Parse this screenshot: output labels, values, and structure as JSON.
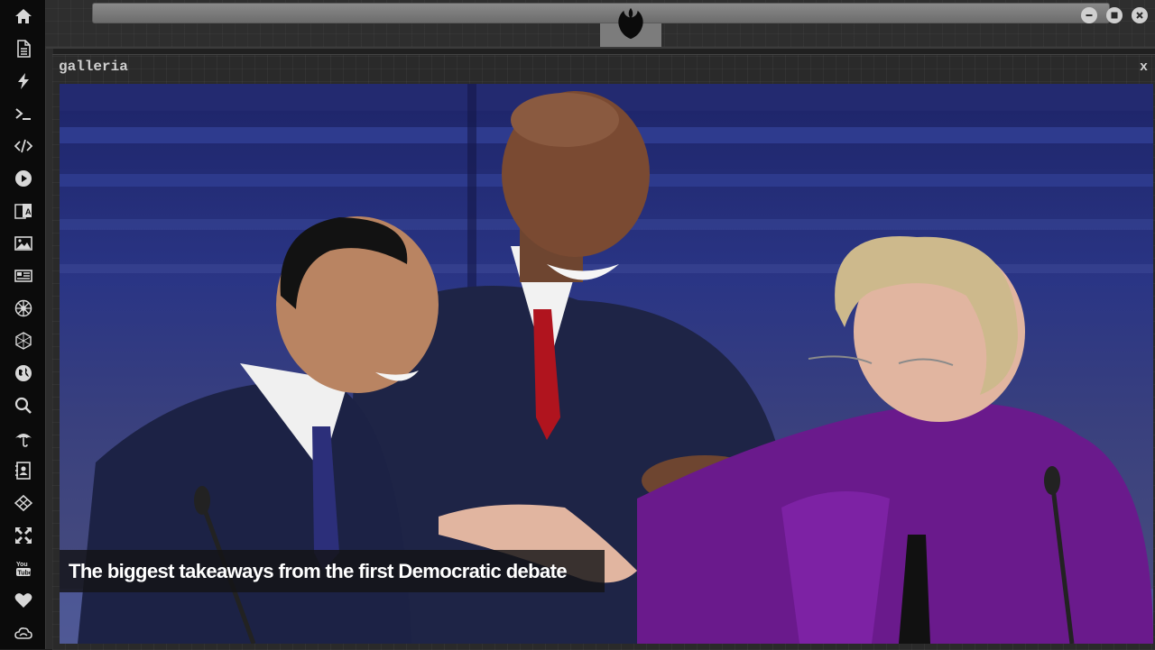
{
  "window": {
    "title": "galleria",
    "close_label": "x"
  },
  "topbar": {
    "logo_icon": "rebel-alliance-icon",
    "buttons": [
      "minimize",
      "maximize",
      "close"
    ]
  },
  "dock": {
    "items": [
      {
        "name": "home",
        "icon": "home-icon"
      },
      {
        "name": "document",
        "icon": "document-icon"
      },
      {
        "name": "bolt",
        "icon": "bolt-icon"
      },
      {
        "name": "terminal",
        "icon": "terminal-icon"
      },
      {
        "name": "code",
        "icon": "code-icon"
      },
      {
        "name": "play",
        "icon": "play-icon"
      },
      {
        "name": "translate",
        "icon": "translate-icon"
      },
      {
        "name": "image",
        "icon": "image-icon"
      },
      {
        "name": "news",
        "icon": "newspaper-icon"
      },
      {
        "name": "empire",
        "icon": "empire-icon"
      },
      {
        "name": "hexagon",
        "icon": "hexagon-icon"
      },
      {
        "name": "globe",
        "icon": "globe-icon"
      },
      {
        "name": "search",
        "icon": "search-icon"
      },
      {
        "name": "umbrella",
        "icon": "umbrella-icon"
      },
      {
        "name": "contacts",
        "icon": "address-book-icon"
      },
      {
        "name": "codepen",
        "icon": "codepen-icon"
      },
      {
        "name": "expand",
        "icon": "expand-icon"
      },
      {
        "name": "youtube",
        "icon": "youtube-icon"
      },
      {
        "name": "heart",
        "icon": "heart-icon"
      },
      {
        "name": "cloud",
        "icon": "cloud-icon"
      }
    ]
  },
  "gallery": {
    "caption": "The biggest takeaways from the first Democratic debate"
  },
  "colors": {
    "dock_bg": "#0b0b0b",
    "icon": "#d8d8d8",
    "panel_bg": "#2a2a2a"
  }
}
